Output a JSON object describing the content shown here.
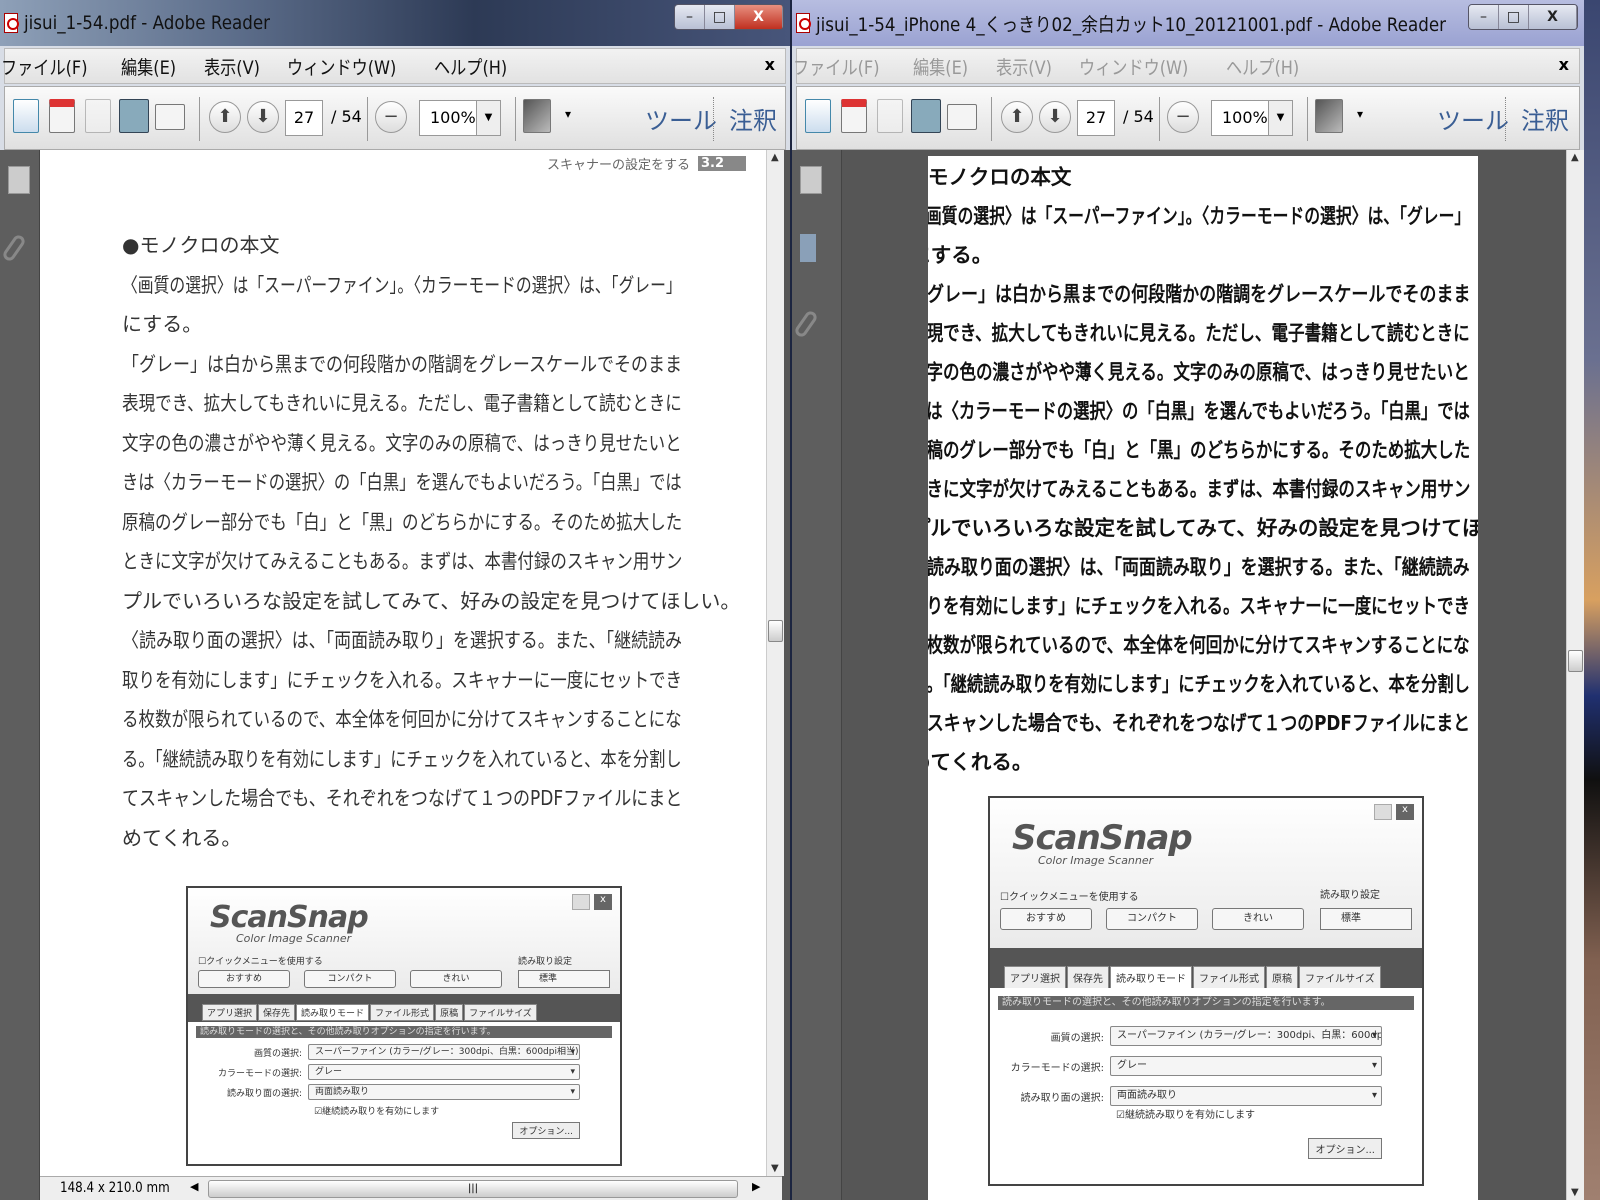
{
  "windows": {
    "left": {
      "title": "jisui_1-54.pdf - Adobe Reader",
      "status_dimensions": "148.4 x 210.0 mm",
      "running_head": "スキャナーの設定をする",
      "section": "3.2"
    },
    "right": {
      "title": "jisui_1-54_iPhone 4_くっきり02_余白カット10_20121001.pdf - Adobe Reader"
    }
  },
  "menu": [
    "ファイル(F)",
    "編集(E)",
    "表示(V)",
    "ウィンドウ(W)",
    "ヘルプ(H)"
  ],
  "menu_close": "x",
  "toolbar": {
    "current_page": "27",
    "total_pages": "/ 54",
    "zoom": "100%",
    "tools": "ツール",
    "comment": "注釈"
  },
  "window_buttons": {
    "minimize": "–",
    "maximize": "□",
    "close": "X"
  },
  "body_lines": [
    "●モノクロの本文",
    "〈画質の選択〉は「スーパーファイン」。〈カラーモードの選択〉は、「グレー」",
    "にする。",
    "「グレー」は白から黒までの何段階かの階調をグレースケールでそのまま",
    "表現でき、拡大してもきれいに見える。ただし、電子書籍として読むときに",
    "文字の色の濃さがやや薄く見える。文字のみの原稿で、はっきり見せたいと",
    "きは〈カラーモードの選択〉の「白黒」を選んでもよいだろう。「白黒」では",
    "原稿のグレー部分でも「白」と「黒」のどちらかにする。そのため拡大した",
    "ときに文字が欠けてみえることもある。まずは、本書付録のスキャン用サン",
    "プルでいろいろな設定を試してみて、好みの設定を見つけてほしい。",
    "〈読み取り面の選択〉は、「両面読み取り」を選択する。また、「継続読み",
    "取りを有効にします」にチェックを入れる。スキャナーに一度にセットでき",
    "る枚数が限られているので、本全体を何回かに分けてスキャンすることにな",
    "る。「継続読み取りを有効にします」にチェックを入れていると、本を分割し",
    "てスキャンした場合でも、それぞれをつなげて１つのPDFファイルにまと",
    "めてくれる。"
  ],
  "scansnap": {
    "logo": "ScanSnap",
    "logo_sub": "Color Image Scanner",
    "quick_menu": "クイックメニューを使用する",
    "presets": [
      "おすすめ",
      "コンパクト",
      "きれい"
    ],
    "read_setting_label": "読み取り設定",
    "read_setting_value": "標準",
    "tabs": [
      "アプリ選択",
      "保存先",
      "読み取りモード",
      "ファイル形式",
      "原稿",
      "ファイルサイズ"
    ],
    "banner": "読み取りモードの選択と、その他読み取りオプションの指定を行います。",
    "fields": [
      {
        "label": "画質の選択:",
        "value": "スーパーファイン (カラー/グレー：300dpi、白黒：600dpi相当)"
      },
      {
        "label": "カラーモードの選択:",
        "value": "グレー"
      },
      {
        "label": "読み取り面の選択:",
        "value": "両面読み取り"
      }
    ],
    "continuous": "継続読み取りを有効にします",
    "options_button": "オプション..."
  }
}
